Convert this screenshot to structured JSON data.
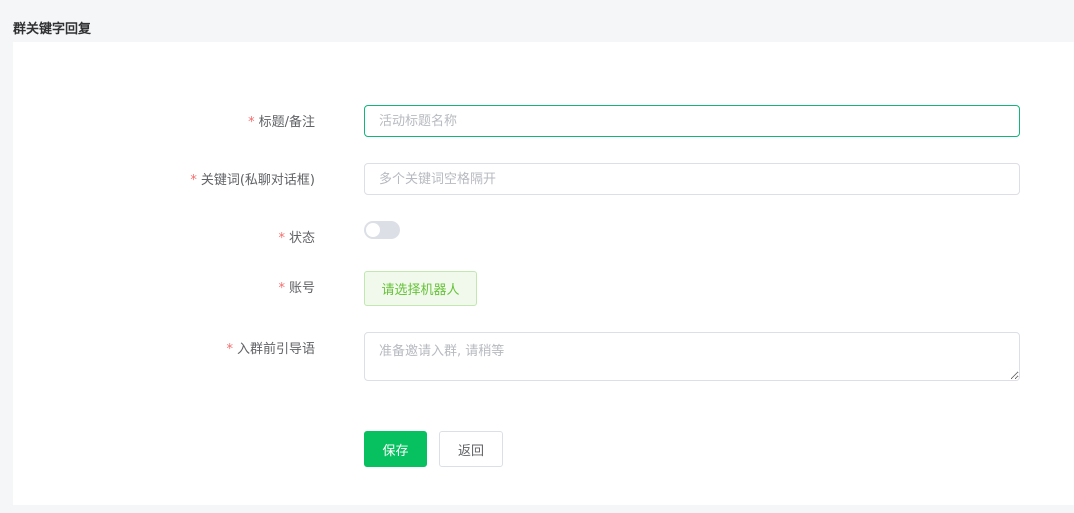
{
  "page": {
    "title": "群关键字回复"
  },
  "form": {
    "title_field": {
      "required_mark": "*",
      "label": "标题/备注",
      "value": "",
      "placeholder": "活动标题名称"
    },
    "keywords_field": {
      "required_mark": "*",
      "label": "关键词(私聊对话框)",
      "value": "",
      "placeholder": "多个关键词空格隔开"
    },
    "status_field": {
      "required_mark": "*",
      "label": "状态",
      "enabled": false
    },
    "account_field": {
      "required_mark": "*",
      "label": "账号",
      "button_label": "请选择机器人"
    },
    "guide_field": {
      "required_mark": "*",
      "label": "入群前引导语",
      "value": "",
      "placeholder": "准备邀请入群, 请稍等"
    }
  },
  "actions": {
    "save_label": "保存",
    "back_label": "返回"
  },
  "colors": {
    "primary": "#07c160",
    "focus_border": "#13b57a",
    "required": "#f56c6c",
    "robot_button_text": "#67c23a"
  }
}
